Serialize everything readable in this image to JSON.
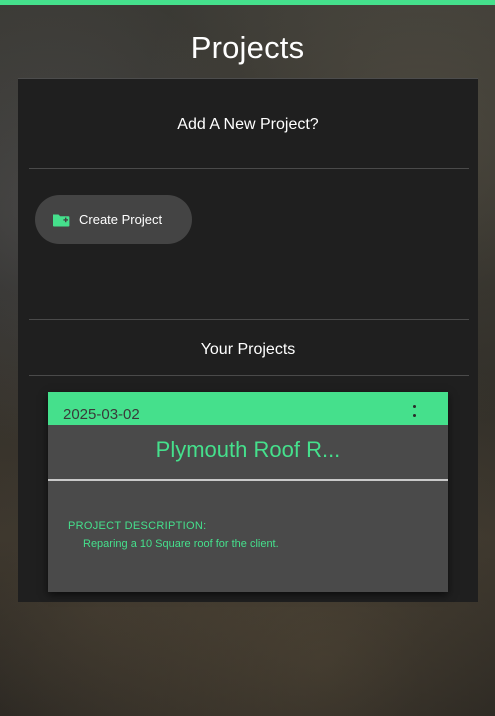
{
  "header": {
    "title": "Projects"
  },
  "add_section": {
    "heading": "Add A New Project?",
    "create_button_label": "Create Project",
    "create_button_icon": "folder-plus-icon"
  },
  "projects_section": {
    "heading": "Your Projects",
    "projects": [
      {
        "date": "2025-03-02",
        "title": "Plymouth Roof R...",
        "description_label": "PROJECT DESCRIPTION:",
        "description": "Reparing a 10 Square roof for the client.",
        "menu_icon": "more-vertical-icon"
      }
    ]
  },
  "colors": {
    "accent": "#45e08c",
    "panel": "#1f1f1f",
    "card": "#4a4a4a",
    "button": "#444444"
  }
}
